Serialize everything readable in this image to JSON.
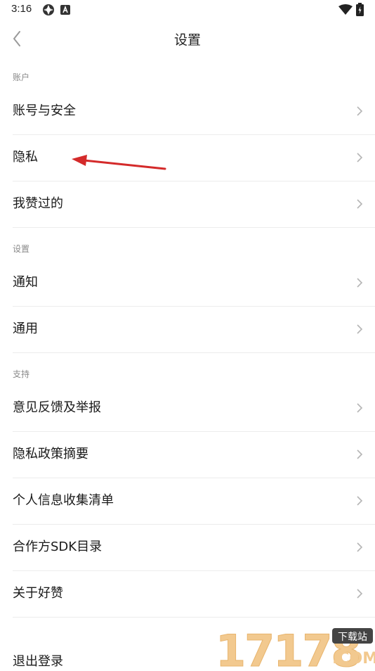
{
  "status_bar": {
    "time": "3:16"
  },
  "header": {
    "title": "设置"
  },
  "sections": [
    {
      "label": "账户",
      "items": [
        "账号与安全",
        "隐私",
        "我赞过的"
      ]
    },
    {
      "label": "设置",
      "items": [
        "通知",
        "通用"
      ]
    },
    {
      "label": "支持",
      "items": [
        "意见反馈及举报",
        "隐私政策摘要",
        "个人信息收集清单",
        "合作方SDK目录",
        "关于好赞"
      ]
    }
  ],
  "footer": {
    "logout_label": "退出登录"
  },
  "watermark": {
    "number": "17178",
    "badge": "下载站",
    "suffix": ".COM"
  },
  "colors": {
    "annotation_arrow": "#d42a2a",
    "divider": "#ececec",
    "watermark": "#f2c98f"
  }
}
